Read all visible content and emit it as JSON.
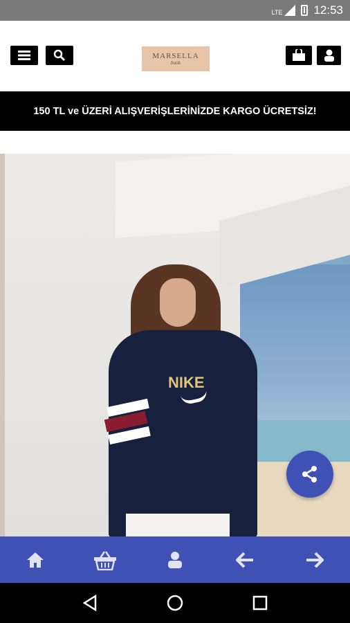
{
  "status_bar": {
    "network": "LTE",
    "time": "12:53"
  },
  "header": {
    "menu_icon": "menu-icon",
    "search_icon": "search-icon",
    "logo_text": "MARSELLA",
    "logo_sub": "butik",
    "cart_icon": "shopping-bag-icon",
    "account_icon": "user-icon"
  },
  "promo": {
    "text": "150 TL ve ÜZERİ ALIŞVERİŞLERİNİZDE KARGO ÜCRETSİZ!"
  },
  "hero": {
    "shirt_text": "NIKE"
  },
  "fab": {
    "icon": "share-icon",
    "color": "#3f51b5"
  },
  "bottom_nav": {
    "color": "#3f51b5",
    "items": [
      "home-icon",
      "basket-icon",
      "user-icon",
      "arrow-left-icon",
      "arrow-right-icon"
    ]
  },
  "android_nav": [
    "back-icon",
    "home-circle-icon",
    "recents-icon"
  ]
}
